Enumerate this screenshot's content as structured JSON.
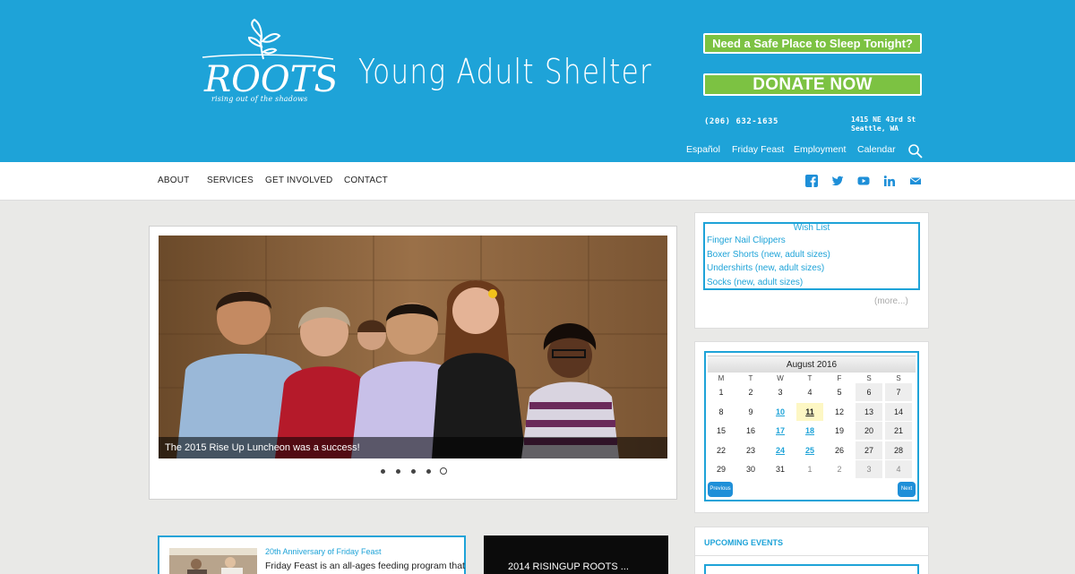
{
  "brand": {
    "logo_text": "ROOTS",
    "tagline": "rising out of the shadows",
    "site_title": "Young Adult Shelter",
    "header_color": "#1ea3d8",
    "accent_green": "#7cc242"
  },
  "header": {
    "safe_place_label": "Need a Safe Place to Sleep Tonight?",
    "donate_label": "DONATE NOW",
    "phone": "(206) 632-1635",
    "address_line1": "1415 NE 43rd St",
    "address_line2": "Seattle, WA",
    "utility_links": [
      "Español",
      "Friday Feast",
      "Employment",
      "Calendar"
    ],
    "search_icon": "search-icon"
  },
  "nav": {
    "items": [
      "ABOUT",
      "SERVICES",
      "GET INVOLVED",
      "CONTACT"
    ],
    "social_icons": [
      "facebook-icon",
      "twitter-icon",
      "youtube-icon",
      "linkedin-icon",
      "email-icon"
    ]
  },
  "slider": {
    "caption": "The 2015 Rise Up Luncheon was a success!",
    "slide_count": 5,
    "active_slide": 5
  },
  "wishlist": {
    "title": "Wish List",
    "items": [
      "Finger Nail Clippers",
      "Boxer Shorts (new, adult sizes)",
      "Undershirts (new, adult sizes)",
      "Socks (new, adult sizes)"
    ],
    "more_label": "(more...)"
  },
  "calendar": {
    "month_label": "August 2016",
    "weekdays": [
      "M",
      "T",
      "W",
      "T",
      "F",
      "S",
      "S"
    ],
    "weeks": [
      [
        "1",
        "2",
        "3",
        "4",
        "5",
        "6",
        "7"
      ],
      [
        "8",
        "9",
        "10",
        "11",
        "12",
        "13",
        "14"
      ],
      [
        "15",
        "16",
        "17",
        "18",
        "19",
        "20",
        "21"
      ],
      [
        "22",
        "23",
        "24",
        "25",
        "26",
        "27",
        "28"
      ],
      [
        "29",
        "30",
        "31",
        "1",
        "2",
        "3",
        "4"
      ]
    ],
    "event_days": [
      "10",
      "17",
      "18",
      "24",
      "25"
    ],
    "today": "11",
    "prev_label": "Previous",
    "next_label": "Next"
  },
  "news": {
    "title": "20th Anniversary of Friday Feast",
    "excerpt": "Friday Feast is an all-ages feeding program that"
  },
  "video": {
    "title": "2014 RISINGUP ROOTS ..."
  },
  "events": {
    "title": "UPCOMING EVENTS"
  }
}
